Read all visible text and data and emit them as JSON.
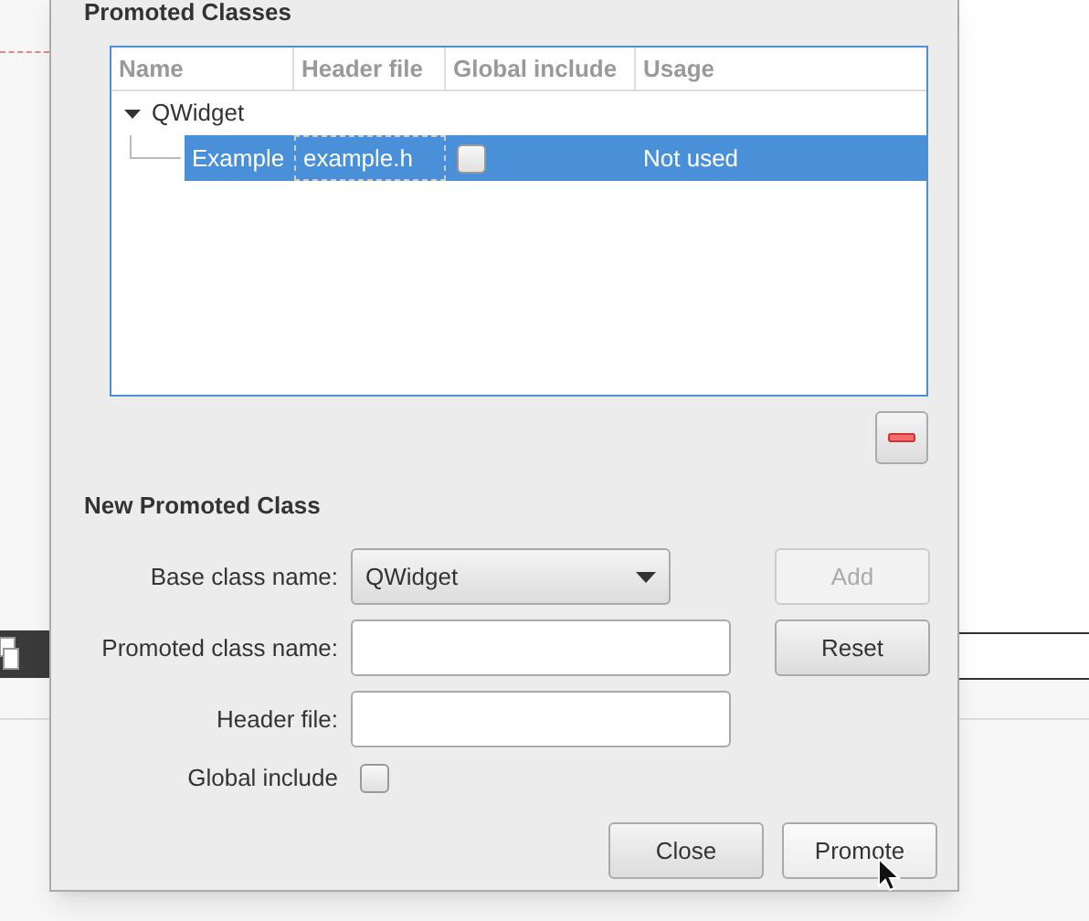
{
  "section_title": "Promoted Classes",
  "table": {
    "columns": [
      "Name",
      "Header file",
      "Global include",
      "Usage"
    ],
    "rows": [
      {
        "name": "QWidget",
        "expanded": true,
        "selected": false,
        "children": [
          {
            "name": "Example",
            "header_file": "example.h",
            "global_include": false,
            "usage": "Not used",
            "selected": true
          }
        ]
      }
    ]
  },
  "new_class": {
    "title": "New Promoted Class",
    "base_class": {
      "label": "Base class name:",
      "value": "QWidget"
    },
    "promoted_class": {
      "label": "Promoted class name:"
    },
    "header_file": {
      "label": "Header file:"
    },
    "global_include": {
      "label": "Global include",
      "checked": false
    }
  },
  "side_buttons": [
    {
      "label": "Add",
      "disabled": true
    },
    {
      "label": "Reset",
      "disabled": false
    }
  ],
  "footer_buttons": [
    {
      "label": "Close"
    },
    {
      "label": "Promote"
    }
  ]
}
